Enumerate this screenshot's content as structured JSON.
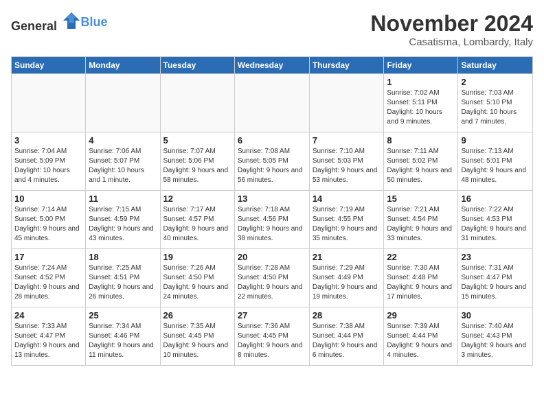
{
  "header": {
    "logo_general": "General",
    "logo_blue": "Blue",
    "month_year": "November 2024",
    "location": "Casatisma, Lombardy, Italy"
  },
  "weekdays": [
    "Sunday",
    "Monday",
    "Tuesday",
    "Wednesday",
    "Thursday",
    "Friday",
    "Saturday"
  ],
  "weeks": [
    [
      {
        "day": "",
        "info": ""
      },
      {
        "day": "",
        "info": ""
      },
      {
        "day": "",
        "info": ""
      },
      {
        "day": "",
        "info": ""
      },
      {
        "day": "",
        "info": ""
      },
      {
        "day": "1",
        "info": "Sunrise: 7:02 AM\nSunset: 5:11 PM\nDaylight: 10 hours and 9 minutes."
      },
      {
        "day": "2",
        "info": "Sunrise: 7:03 AM\nSunset: 5:10 PM\nDaylight: 10 hours and 7 minutes."
      }
    ],
    [
      {
        "day": "3",
        "info": "Sunrise: 7:04 AM\nSunset: 5:09 PM\nDaylight: 10 hours and 4 minutes."
      },
      {
        "day": "4",
        "info": "Sunrise: 7:06 AM\nSunset: 5:07 PM\nDaylight: 10 hours and 1 minute."
      },
      {
        "day": "5",
        "info": "Sunrise: 7:07 AM\nSunset: 5:06 PM\nDaylight: 9 hours and 58 minutes."
      },
      {
        "day": "6",
        "info": "Sunrise: 7:08 AM\nSunset: 5:05 PM\nDaylight: 9 hours and 56 minutes."
      },
      {
        "day": "7",
        "info": "Sunrise: 7:10 AM\nSunset: 5:03 PM\nDaylight: 9 hours and 53 minutes."
      },
      {
        "day": "8",
        "info": "Sunrise: 7:11 AM\nSunset: 5:02 PM\nDaylight: 9 hours and 50 minutes."
      },
      {
        "day": "9",
        "info": "Sunrise: 7:13 AM\nSunset: 5:01 PM\nDaylight: 9 hours and 48 minutes."
      }
    ],
    [
      {
        "day": "10",
        "info": "Sunrise: 7:14 AM\nSunset: 5:00 PM\nDaylight: 9 hours and 45 minutes."
      },
      {
        "day": "11",
        "info": "Sunrise: 7:15 AM\nSunset: 4:59 PM\nDaylight: 9 hours and 43 minutes."
      },
      {
        "day": "12",
        "info": "Sunrise: 7:17 AM\nSunset: 4:57 PM\nDaylight: 9 hours and 40 minutes."
      },
      {
        "day": "13",
        "info": "Sunrise: 7:18 AM\nSunset: 4:56 PM\nDaylight: 9 hours and 38 minutes."
      },
      {
        "day": "14",
        "info": "Sunrise: 7:19 AM\nSunset: 4:55 PM\nDaylight: 9 hours and 35 minutes."
      },
      {
        "day": "15",
        "info": "Sunrise: 7:21 AM\nSunset: 4:54 PM\nDaylight: 9 hours and 33 minutes."
      },
      {
        "day": "16",
        "info": "Sunrise: 7:22 AM\nSunset: 4:53 PM\nDaylight: 9 hours and 31 minutes."
      }
    ],
    [
      {
        "day": "17",
        "info": "Sunrise: 7:24 AM\nSunset: 4:52 PM\nDaylight: 9 hours and 28 minutes."
      },
      {
        "day": "18",
        "info": "Sunrise: 7:25 AM\nSunset: 4:51 PM\nDaylight: 9 hours and 26 minutes."
      },
      {
        "day": "19",
        "info": "Sunrise: 7:26 AM\nSunset: 4:50 PM\nDaylight: 9 hours and 24 minutes."
      },
      {
        "day": "20",
        "info": "Sunrise: 7:28 AM\nSunset: 4:50 PM\nDaylight: 9 hours and 22 minutes."
      },
      {
        "day": "21",
        "info": "Sunrise: 7:29 AM\nSunset: 4:49 PM\nDaylight: 9 hours and 19 minutes."
      },
      {
        "day": "22",
        "info": "Sunrise: 7:30 AM\nSunset: 4:48 PM\nDaylight: 9 hours and 17 minutes."
      },
      {
        "day": "23",
        "info": "Sunrise: 7:31 AM\nSunset: 4:47 PM\nDaylight: 9 hours and 15 minutes."
      }
    ],
    [
      {
        "day": "24",
        "info": "Sunrise: 7:33 AM\nSunset: 4:47 PM\nDaylight: 9 hours and 13 minutes."
      },
      {
        "day": "25",
        "info": "Sunrise: 7:34 AM\nSunset: 4:46 PM\nDaylight: 9 hours and 11 minutes."
      },
      {
        "day": "26",
        "info": "Sunrise: 7:35 AM\nSunset: 4:45 PM\nDaylight: 9 hours and 10 minutes."
      },
      {
        "day": "27",
        "info": "Sunrise: 7:36 AM\nSunset: 4:45 PM\nDaylight: 9 hours and 8 minutes."
      },
      {
        "day": "28",
        "info": "Sunrise: 7:38 AM\nSunset: 4:44 PM\nDaylight: 9 hours and 6 minutes."
      },
      {
        "day": "29",
        "info": "Sunrise: 7:39 AM\nSunset: 4:44 PM\nDaylight: 9 hours and 4 minutes."
      },
      {
        "day": "30",
        "info": "Sunrise: 7:40 AM\nSunset: 4:43 PM\nDaylight: 9 hours and 3 minutes."
      }
    ]
  ]
}
